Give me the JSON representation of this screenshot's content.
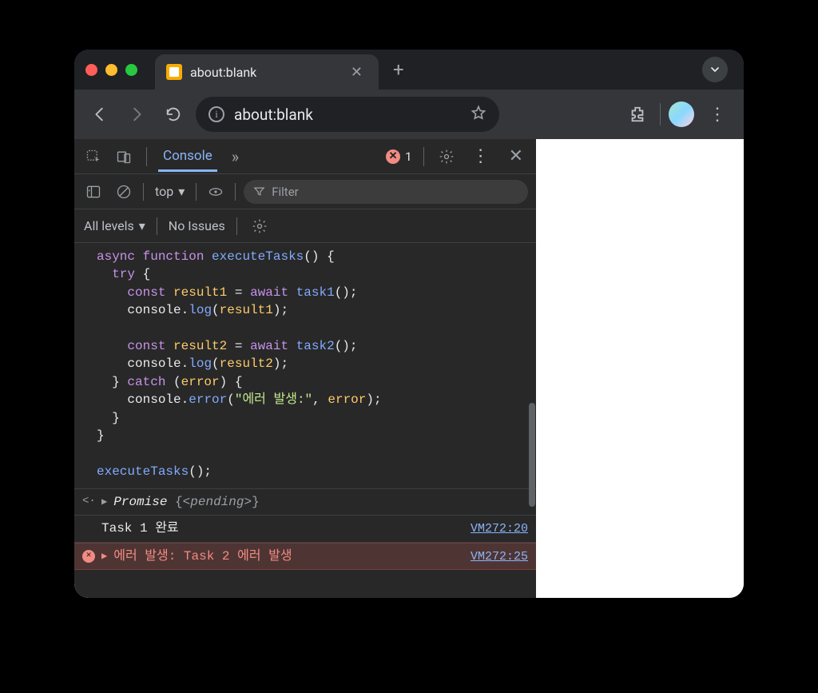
{
  "tab": {
    "title": "about:blank"
  },
  "address": {
    "url": "about:blank"
  },
  "devtools": {
    "active_tab": "Console",
    "error_count": "1",
    "console_bar": {
      "scope": "top",
      "filter_placeholder": "Filter"
    },
    "levels": {
      "label": "All levels",
      "issues": "No Issues"
    },
    "code": "async function executeTasks() {\n  try {\n    const result1 = await task1();\n    console.log(result1);\n\n    const result2 = await task2();\n    console.log(result2);\n  } catch (error) {\n    console.error(\"에러 발생:\", error);\n  }\n}\n\nexecuteTasks();",
    "output": {
      "return": {
        "label": "Promise",
        "state": "<pending>"
      },
      "log1": {
        "text": "Task 1 완료",
        "source": "VM272:20"
      },
      "error1": {
        "text": "에러 발생: Task 2 에러 발생",
        "source": "VM272:25"
      }
    }
  }
}
